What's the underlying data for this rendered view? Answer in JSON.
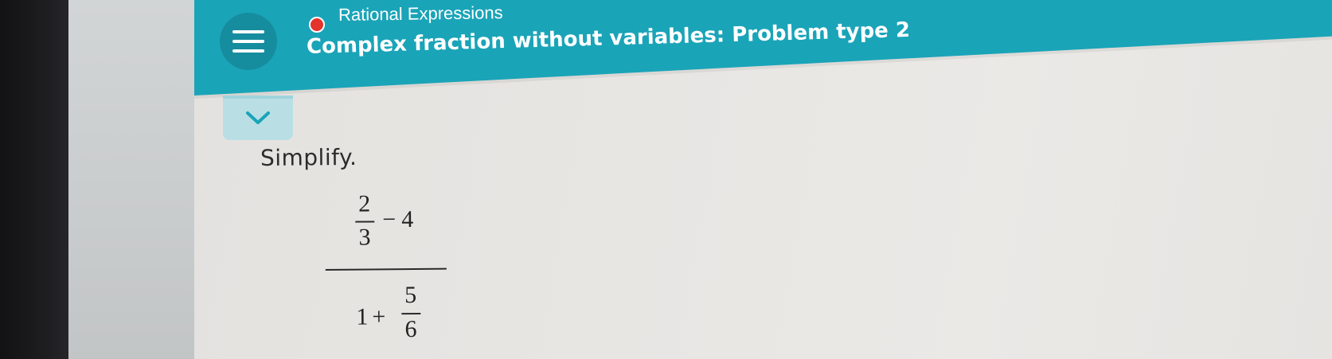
{
  "header": {
    "topic": "Rational Expressions",
    "title": "Complex fraction without variables: Problem type 2",
    "status_color": "#e3332b",
    "accent_color": "#1aa4b8",
    "menu_icon": "hamburger-menu-icon",
    "collapse_icon": "chevron-down-icon"
  },
  "problem": {
    "instruction": "Simplify.",
    "expression": {
      "numerator": {
        "fraction": {
          "numerator": "2",
          "denominator": "3"
        },
        "operator": "−",
        "term": "4"
      },
      "denominator": {
        "term": "1",
        "operator": "+",
        "fraction": {
          "numerator": "5",
          "denominator": "6"
        }
      }
    }
  }
}
